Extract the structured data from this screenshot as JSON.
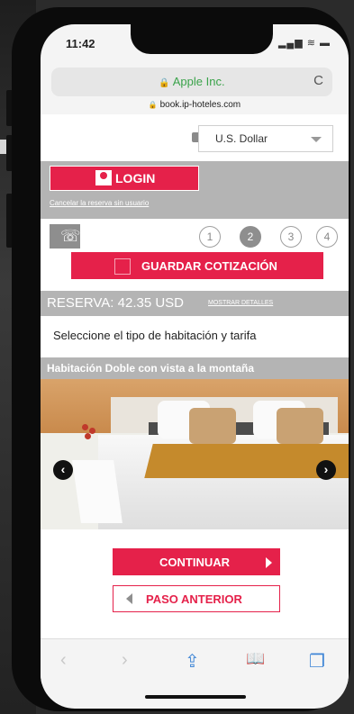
{
  "status_bar": {
    "time": "11:42",
    "icons": "▂▄▆ ≋ ▬"
  },
  "browser": {
    "lock_icon": "lock-icon",
    "site_title": "Apple Inc.",
    "url": "book.ip-hoteles.com",
    "reload_glyph": "C"
  },
  "currency": {
    "selected": "U.S. Dollar"
  },
  "login": {
    "label": "LOGIN",
    "cancel_link": "Cancelar la reserva sin usuario"
  },
  "steps": [
    "1",
    "2",
    "3",
    "4"
  ],
  "active_step": "2",
  "guardar": {
    "label": "GUARDAR COTIZACIÓN"
  },
  "reserva": {
    "title": "RESERVA: 42.35 USD",
    "details_link": "MOSTRAR DETALLES"
  },
  "instruction": "Seleccione el tipo de habitación y tarifa",
  "room": {
    "title": "Habitación Doble con vista a la montaña"
  },
  "carousel": {
    "prev": "‹",
    "next": "›"
  },
  "actions": {
    "continue": "CONTINUAR",
    "previous": "PASO ANTERIOR"
  },
  "toolbar": {
    "back": "‹",
    "forward": "›",
    "share": "⇪",
    "bookmarks": "📖",
    "tabs": "❐"
  },
  "colors": {
    "accent": "#e5214a",
    "gray_bar": "#b4b4b4",
    "link_green": "#3aa34a"
  }
}
